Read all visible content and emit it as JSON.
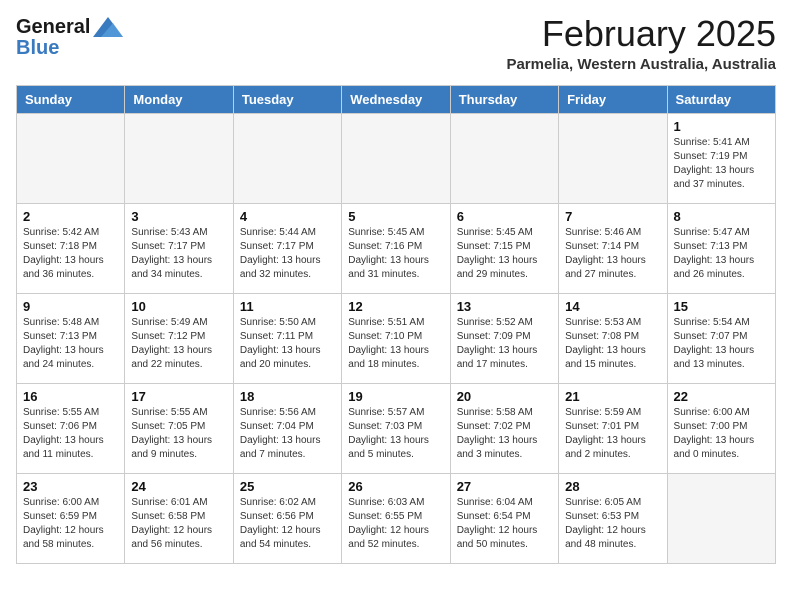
{
  "header": {
    "logo_line1": "General",
    "logo_line2": "Blue",
    "month_year": "February 2025",
    "location": "Parmelia, Western Australia, Australia"
  },
  "weekdays": [
    "Sunday",
    "Monday",
    "Tuesday",
    "Wednesday",
    "Thursday",
    "Friday",
    "Saturday"
  ],
  "weeks": [
    [
      {
        "day": "",
        "info": ""
      },
      {
        "day": "",
        "info": ""
      },
      {
        "day": "",
        "info": ""
      },
      {
        "day": "",
        "info": ""
      },
      {
        "day": "",
        "info": ""
      },
      {
        "day": "",
        "info": ""
      },
      {
        "day": "1",
        "info": "Sunrise: 5:41 AM\nSunset: 7:19 PM\nDaylight: 13 hours\nand 37 minutes."
      }
    ],
    [
      {
        "day": "2",
        "info": "Sunrise: 5:42 AM\nSunset: 7:18 PM\nDaylight: 13 hours\nand 36 minutes."
      },
      {
        "day": "3",
        "info": "Sunrise: 5:43 AM\nSunset: 7:17 PM\nDaylight: 13 hours\nand 34 minutes."
      },
      {
        "day": "4",
        "info": "Sunrise: 5:44 AM\nSunset: 7:17 PM\nDaylight: 13 hours\nand 32 minutes."
      },
      {
        "day": "5",
        "info": "Sunrise: 5:45 AM\nSunset: 7:16 PM\nDaylight: 13 hours\nand 31 minutes."
      },
      {
        "day": "6",
        "info": "Sunrise: 5:45 AM\nSunset: 7:15 PM\nDaylight: 13 hours\nand 29 minutes."
      },
      {
        "day": "7",
        "info": "Sunrise: 5:46 AM\nSunset: 7:14 PM\nDaylight: 13 hours\nand 27 minutes."
      },
      {
        "day": "8",
        "info": "Sunrise: 5:47 AM\nSunset: 7:13 PM\nDaylight: 13 hours\nand 26 minutes."
      }
    ],
    [
      {
        "day": "9",
        "info": "Sunrise: 5:48 AM\nSunset: 7:13 PM\nDaylight: 13 hours\nand 24 minutes."
      },
      {
        "day": "10",
        "info": "Sunrise: 5:49 AM\nSunset: 7:12 PM\nDaylight: 13 hours\nand 22 minutes."
      },
      {
        "day": "11",
        "info": "Sunrise: 5:50 AM\nSunset: 7:11 PM\nDaylight: 13 hours\nand 20 minutes."
      },
      {
        "day": "12",
        "info": "Sunrise: 5:51 AM\nSunset: 7:10 PM\nDaylight: 13 hours\nand 18 minutes."
      },
      {
        "day": "13",
        "info": "Sunrise: 5:52 AM\nSunset: 7:09 PM\nDaylight: 13 hours\nand 17 minutes."
      },
      {
        "day": "14",
        "info": "Sunrise: 5:53 AM\nSunset: 7:08 PM\nDaylight: 13 hours\nand 15 minutes."
      },
      {
        "day": "15",
        "info": "Sunrise: 5:54 AM\nSunset: 7:07 PM\nDaylight: 13 hours\nand 13 minutes."
      }
    ],
    [
      {
        "day": "16",
        "info": "Sunrise: 5:55 AM\nSunset: 7:06 PM\nDaylight: 13 hours\nand 11 minutes."
      },
      {
        "day": "17",
        "info": "Sunrise: 5:55 AM\nSunset: 7:05 PM\nDaylight: 13 hours\nand 9 minutes."
      },
      {
        "day": "18",
        "info": "Sunrise: 5:56 AM\nSunset: 7:04 PM\nDaylight: 13 hours\nand 7 minutes."
      },
      {
        "day": "19",
        "info": "Sunrise: 5:57 AM\nSunset: 7:03 PM\nDaylight: 13 hours\nand 5 minutes."
      },
      {
        "day": "20",
        "info": "Sunrise: 5:58 AM\nSunset: 7:02 PM\nDaylight: 13 hours\nand 3 minutes."
      },
      {
        "day": "21",
        "info": "Sunrise: 5:59 AM\nSunset: 7:01 PM\nDaylight: 13 hours\nand 2 minutes."
      },
      {
        "day": "22",
        "info": "Sunrise: 6:00 AM\nSunset: 7:00 PM\nDaylight: 13 hours\nand 0 minutes."
      }
    ],
    [
      {
        "day": "23",
        "info": "Sunrise: 6:00 AM\nSunset: 6:59 PM\nDaylight: 12 hours\nand 58 minutes."
      },
      {
        "day": "24",
        "info": "Sunrise: 6:01 AM\nSunset: 6:58 PM\nDaylight: 12 hours\nand 56 minutes."
      },
      {
        "day": "25",
        "info": "Sunrise: 6:02 AM\nSunset: 6:56 PM\nDaylight: 12 hours\nand 54 minutes."
      },
      {
        "day": "26",
        "info": "Sunrise: 6:03 AM\nSunset: 6:55 PM\nDaylight: 12 hours\nand 52 minutes."
      },
      {
        "day": "27",
        "info": "Sunrise: 6:04 AM\nSunset: 6:54 PM\nDaylight: 12 hours\nand 50 minutes."
      },
      {
        "day": "28",
        "info": "Sunrise: 6:05 AM\nSunset: 6:53 PM\nDaylight: 12 hours\nand 48 minutes."
      },
      {
        "day": "",
        "info": ""
      }
    ]
  ]
}
